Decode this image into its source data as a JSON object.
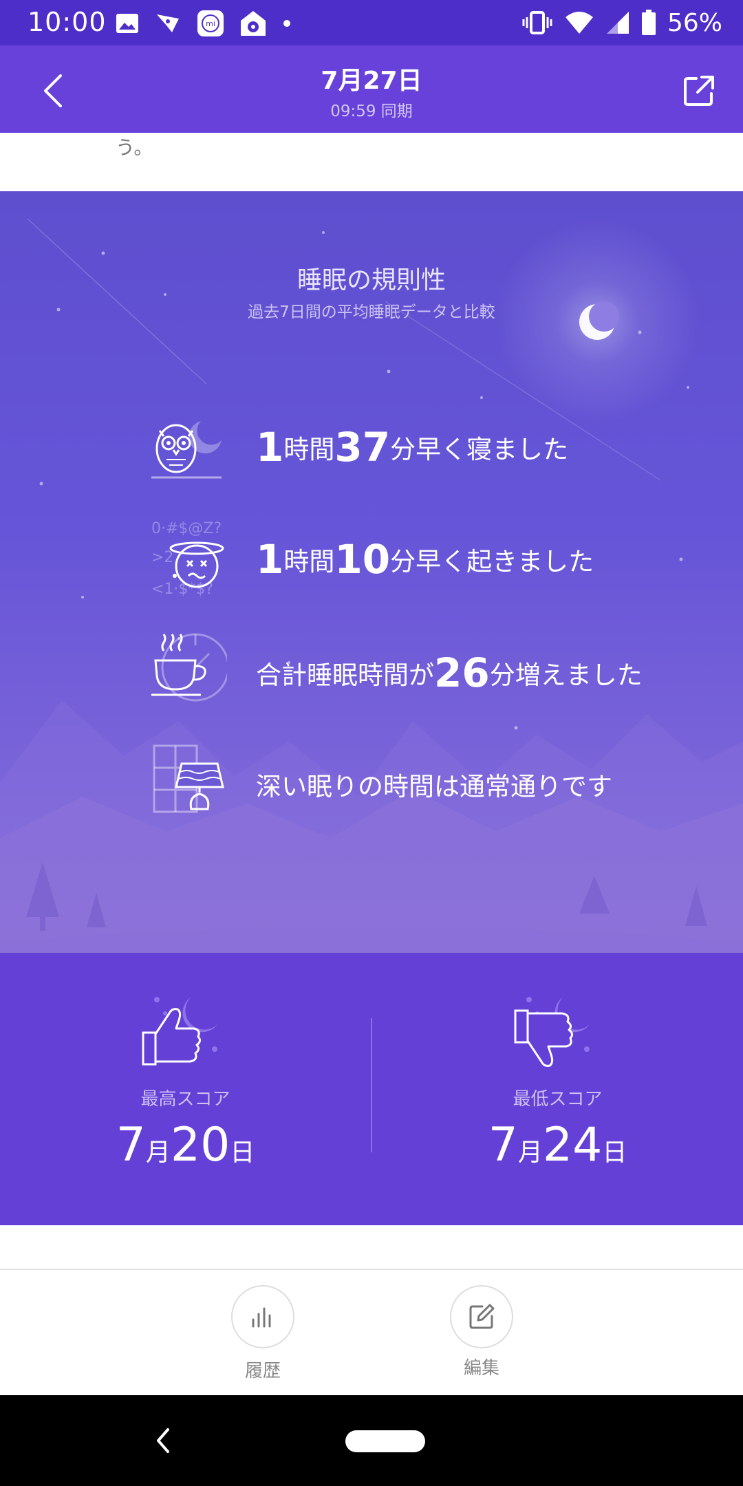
{
  "status_bar": {
    "time": "10:00",
    "battery": "56%"
  },
  "header": {
    "title": "7月27日",
    "subtitle": "09:59 同期"
  },
  "top_strip": {
    "text": "う。"
  },
  "regularity": {
    "title": "睡眠の規則性",
    "subtitle": "過去7日間の平均睡眠データと比較",
    "rows": [
      {
        "icon": "owl-icon",
        "num1": "1",
        "unit1": "時間",
        "num2": "37",
        "rest": "分早く寝ました"
      },
      {
        "icon": "dizzy-face-icon",
        "num1": "1",
        "unit1": "時間",
        "num2": "10",
        "rest": "分早く起きました"
      },
      {
        "icon": "coffee-clock-icon",
        "prefix": "合計睡眠時間が",
        "num": "26",
        "rest": "分増えました"
      },
      {
        "icon": "lamp-window-icon",
        "text": "深い眠りの時間は通常通りです"
      }
    ]
  },
  "scores": {
    "best": {
      "label": "最高スコア",
      "month": "7",
      "month_unit": "月",
      "day": "20",
      "day_unit": "日",
      "icon": "thumbs-up-moon-icon"
    },
    "worst": {
      "label": "最低スコア",
      "month": "7",
      "month_unit": "月",
      "day": "24",
      "day_unit": "日",
      "icon": "thumbs-down-moon-icon"
    }
  },
  "bottom_bar": {
    "history_label": "履歴",
    "edit_label": "編集"
  },
  "colors": {
    "status_bar": "#4d2ec8",
    "header": "#6741d9",
    "scores_bg": "#6440d6"
  }
}
